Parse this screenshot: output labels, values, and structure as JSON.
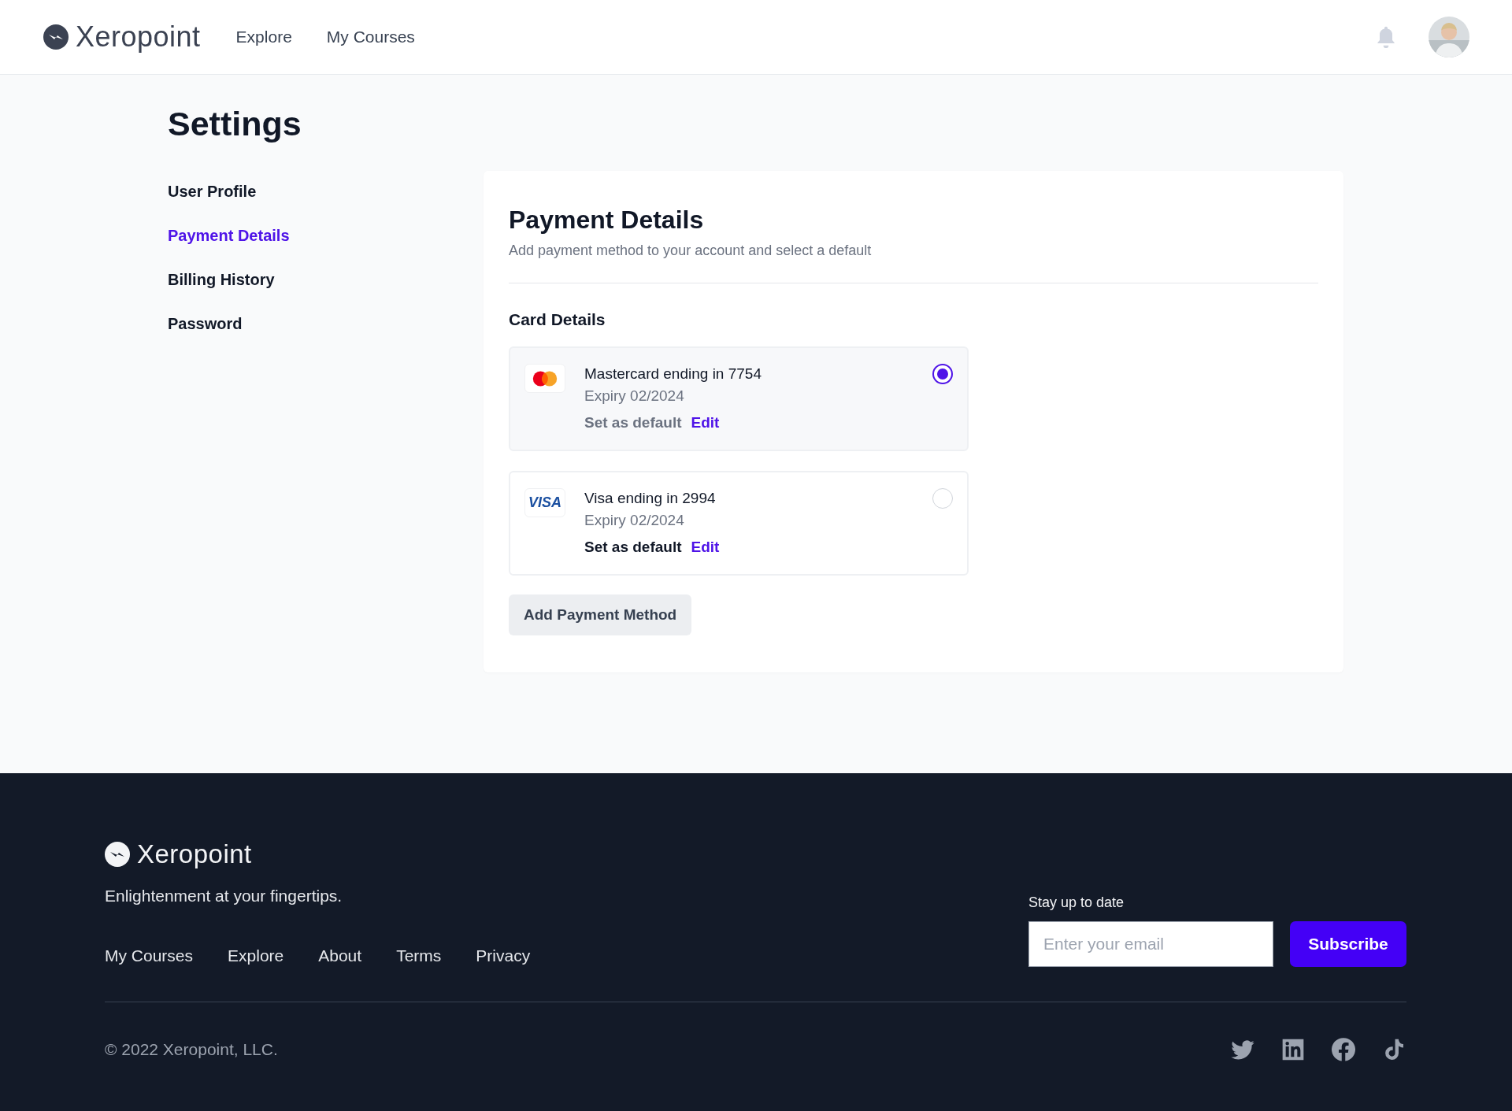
{
  "header": {
    "logo": "Xeropoint",
    "nav": [
      {
        "label": "Explore"
      },
      {
        "label": "My Courses"
      }
    ]
  },
  "page_title": "Settings",
  "sidebar": {
    "items": [
      {
        "label": "User Profile",
        "selected": false
      },
      {
        "label": "Payment Details",
        "selected": true
      },
      {
        "label": "Billing History",
        "selected": false
      },
      {
        "label": "Password",
        "selected": false
      }
    ]
  },
  "panel": {
    "title": "Payment Details",
    "subtitle": "Add payment method to your account and select a default",
    "section_title": "Card Details",
    "cards": [
      {
        "kind": "mastercard",
        "name": "Mastercard ending in 7754",
        "expiry": "Expiry 02/2024",
        "set_default": "Set as default",
        "edit": "Edit",
        "selected": true
      },
      {
        "kind": "visa",
        "brand_text": "VISA",
        "name": "Visa ending in 2994",
        "expiry": "Expiry 02/2024",
        "set_default": "Set as default",
        "edit": "Edit",
        "selected": false
      }
    ],
    "add_button": "Add Payment Method"
  },
  "footer": {
    "logo": "Xeropoint",
    "tagline": "Enlightenment at your fingertips.",
    "links": [
      "My Courses",
      "Explore",
      "About",
      "Terms",
      "Privacy"
    ],
    "subscribe_label": "Stay up to date",
    "email": {
      "placeholder": "Enter your email"
    },
    "subscribe_button": "Subscribe",
    "copyright": "© 2022 Xeropoint, LLC.",
    "social": [
      {
        "kind": "twitter"
      },
      {
        "kind": "linkedin"
      },
      {
        "kind": "facebook"
      },
      {
        "kind": "tiktok"
      }
    ]
  }
}
